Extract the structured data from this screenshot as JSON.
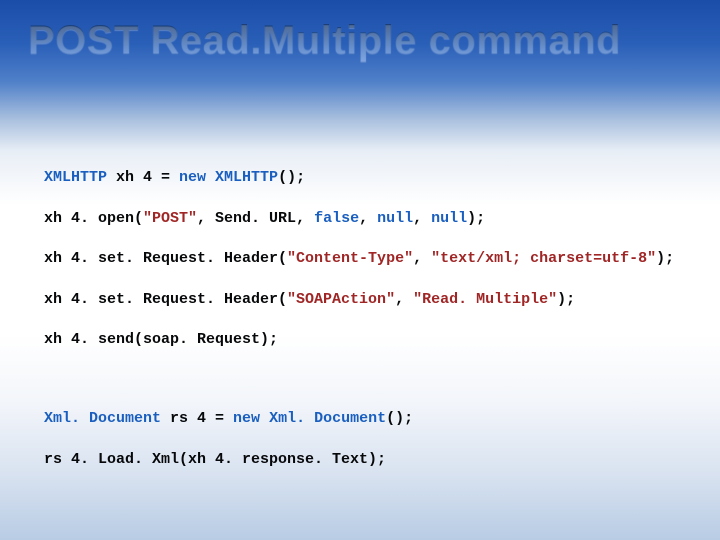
{
  "slide": {
    "title": "POST Read.Multiple command"
  },
  "code": {
    "block1": {
      "l1_t1": "XMLHTTP",
      "l1_rest": " xh 4 = ",
      "l1_kw": "new",
      "l1_t2": " XMLHTTP",
      "l1_end": "();",
      "l2_a": "xh 4. open(",
      "l2_s1": "\"POST\"",
      "l2_b": ", Send. URL, ",
      "l2_kw1": "false",
      "l2_c": ", ",
      "l2_kw2": "null",
      "l2_d": ", ",
      "l2_kw3": "null",
      "l2_e": ");",
      "l3_a": "xh 4. set. Request. Header(",
      "l3_s1": "\"Content-Type\"",
      "l3_b": ", ",
      "l3_s2": "\"text/xml; charset=utf-8\"",
      "l3_c": ");",
      "l4_a": "xh 4. set. Request. Header(",
      "l4_s1": "\"SOAPAction\"",
      "l4_b": ", ",
      "l4_s2": "\"Read. Multiple\"",
      "l4_c": ");",
      "l5": "xh 4. send(soap. Request);"
    },
    "block2": {
      "l1_t1": "Xml. Document",
      "l1_rest": " rs 4 = ",
      "l1_kw": "new",
      "l1_t2": " Xml. Document",
      "l1_end": "();",
      "l2": "rs 4. Load. Xml(xh 4. response. Text);"
    }
  }
}
